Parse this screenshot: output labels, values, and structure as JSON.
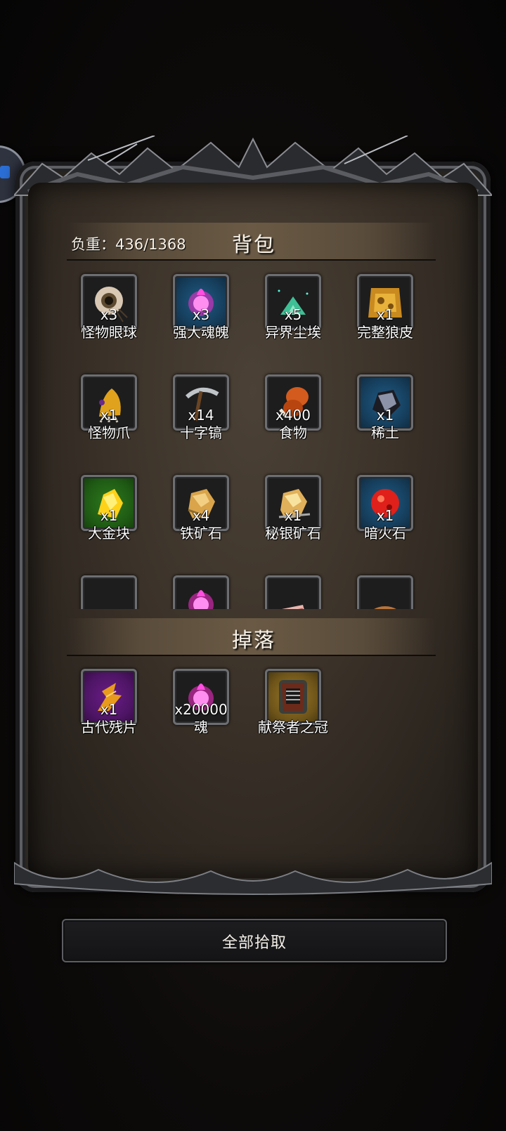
{
  "bag": {
    "weight_label": "负重：436/1368",
    "title": "背包",
    "items": [
      {
        "name": "怪物眼球",
        "count": "x3",
        "icon": "eyeball-icon",
        "bg": "dark"
      },
      {
        "name": "强大魂魄",
        "count": "x3",
        "icon": "pink-soul-icon",
        "bg": "blue"
      },
      {
        "name": "异界尘埃",
        "count": "x5",
        "icon": "teal-dust-icon",
        "bg": "dark"
      },
      {
        "name": "完整狼皮",
        "count": "x1",
        "icon": "wolf-pelt-icon",
        "bg": "dark"
      },
      {
        "name": "怪物爪",
        "count": "x1",
        "icon": "monster-claw-icon",
        "bg": "dark"
      },
      {
        "name": "十字镐",
        "count": "x14",
        "icon": "pickaxe-icon",
        "bg": "dark"
      },
      {
        "name": "食物",
        "count": "x400",
        "icon": "meat-icon",
        "bg": "dark"
      },
      {
        "name": "稀土",
        "count": "x1",
        "icon": "rare-earth-icon",
        "bg": "blue"
      },
      {
        "name": "大金块",
        "count": "x1",
        "icon": "gold-nugget-icon",
        "bg": "green"
      },
      {
        "name": "铁矿石",
        "count": "x4",
        "icon": "iron-ore-icon",
        "bg": "dark"
      },
      {
        "name": "秘银矿石",
        "count": "x1",
        "icon": "mithril-ore-icon",
        "bg": "dark"
      },
      {
        "name": "暗火石",
        "count": "x1",
        "icon": "dark-fire-stone-icon",
        "bg": "blue"
      },
      {
        "name": "",
        "count": "",
        "icon": "dark-rock-icon",
        "bg": "dark"
      },
      {
        "name": "",
        "count": "",
        "icon": "pink-soul-icon",
        "bg": "dark"
      },
      {
        "name": "",
        "count": "",
        "icon": "raw-meat-icon",
        "bg": "dark"
      },
      {
        "name": "",
        "count": "",
        "icon": "bread-icon",
        "bg": "dark"
      }
    ]
  },
  "drops": {
    "title": "掉落",
    "items": [
      {
        "name": "古代残片",
        "count": "x1",
        "icon": "ancient-fragment-icon",
        "bg": "purple"
      },
      {
        "name": "魂",
        "count": "x20000",
        "icon": "pink-soul-icon",
        "bg": "dark"
      },
      {
        "name": "献祭者之冠",
        "count": "",
        "icon": "sacrificer-crown-icon",
        "bg": "gold"
      }
    ]
  },
  "pickup_all_label": "全部拾取"
}
